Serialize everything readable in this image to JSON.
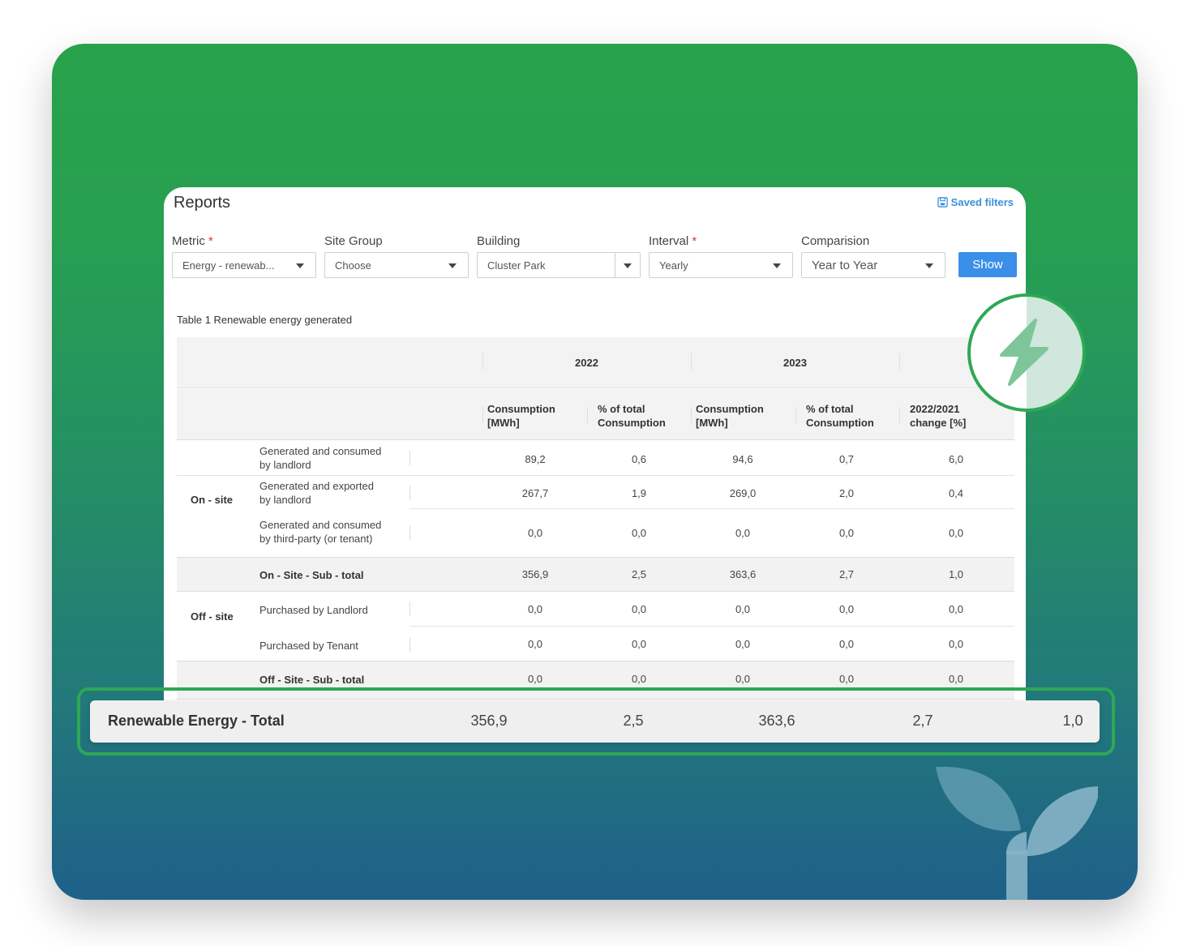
{
  "report": {
    "title": "Reports",
    "saved_filters": "Saved filters",
    "show_button": "Show"
  },
  "filters": [
    {
      "label": "Metric",
      "required": "*",
      "value": "Energy - renewab..."
    },
    {
      "label": "Site Group",
      "required": "",
      "value": "Choose"
    },
    {
      "label": "Building",
      "required": "",
      "value": "Cluster Park"
    },
    {
      "label": "Interval",
      "required": "*",
      "value": "Yearly"
    },
    {
      "label": "Comparision",
      "required": "",
      "value": "Year to Year"
    }
  ],
  "table": {
    "caption": "Table 1 Renewable energy generated",
    "years": [
      "2022",
      "2023"
    ],
    "columns": [
      "Consumption\n[MWh]",
      "% of total\nConsumption",
      "Consumption\n[MWh]",
      "% of total\nConsumption",
      "2022/2021\nchange [%]"
    ],
    "groups": {
      "on_site": "On - site",
      "off_site": "Off - site"
    },
    "rows": [
      {
        "label": "Generated and consumed\nby landlord",
        "values": [
          "89,2",
          "0,6",
          "94,6",
          "0,7",
          "6,0"
        ]
      },
      {
        "label": "Generated and exported\nby landlord",
        "values": [
          "267,7",
          "1,9",
          "269,0",
          "2,0",
          "0,4"
        ]
      },
      {
        "label": "Generated and consumed\nby third-party (or tenant)",
        "values": [
          "0,0",
          "0,0",
          "0,0",
          "0,0",
          "0,0"
        ]
      },
      {
        "label": "On - Site - Sub - total",
        "values": [
          "356,9",
          "2,5",
          "363,6",
          "2,7",
          "1,0"
        ]
      },
      {
        "label": "Purchased by Landlord",
        "values": [
          "0,0",
          "0,0",
          "0,0",
          "0,0",
          "0,0"
        ]
      },
      {
        "label": "Purchased by Tenant",
        "values": [
          "0,0",
          "0,0",
          "0,0",
          "0,0",
          "0,0"
        ]
      },
      {
        "label": "Off - Site - Sub - total",
        "values": [
          "0,0",
          "0,0",
          "0,0",
          "0,0",
          "0,0"
        ]
      }
    ],
    "total": {
      "label": "Renewable Energy - Total",
      "values": [
        "356,9",
        "2,5",
        "363,6",
        "2,7",
        "1,0"
      ]
    }
  },
  "colors": {
    "accent_green": "#2ea854",
    "button_blue": "#3a8fe8",
    "link_blue": "#3a8fd9"
  },
  "icons": [
    "save-icon",
    "caret-down-icon",
    "lightning-icon",
    "leaf-sprout-icon"
  ]
}
